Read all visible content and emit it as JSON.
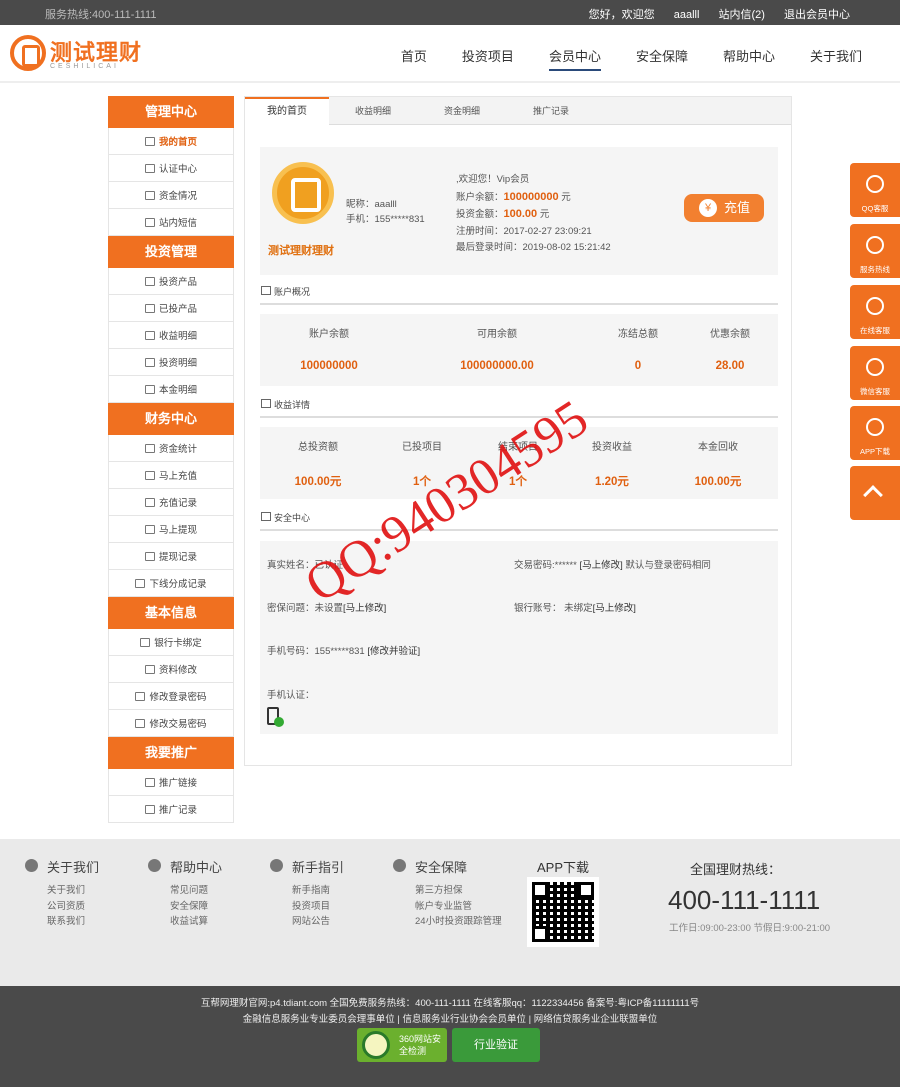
{
  "topbar": {
    "hotline": "服务热线:400-111-1111",
    "greeting": "您好，欢迎您",
    "username": "aaalll",
    "inbox": "站内信(2)",
    "logout": "退出会员中心"
  },
  "logo": {
    "name": "测试理财",
    "sub": "CESHILICAI"
  },
  "nav": [
    "首页",
    "投资项目",
    "会员中心",
    "安全保障",
    "帮助中心",
    "关于我们"
  ],
  "sidebar": [
    {
      "title": "管理中心",
      "items": [
        "我的首页",
        "认证中心",
        "资金情况",
        "站内短信"
      ]
    },
    {
      "title": "投资管理",
      "items": [
        "投资产品",
        "已投产品",
        "收益明细",
        "投资明细",
        "本金明细"
      ]
    },
    {
      "title": "财务中心",
      "items": [
        "资金统计",
        "马上充值",
        "充值记录",
        "马上提现",
        "提现记录",
        "下线分成记录"
      ]
    },
    {
      "title": "基本信息",
      "items": [
        "银行卡绑定",
        "资料修改",
        "修改登录密码",
        "修改交易密码"
      ]
    },
    {
      "title": "我要推广",
      "items": [
        "推广链接",
        "推广记录"
      ]
    }
  ],
  "tabs": [
    "我的首页",
    "收益明细",
    "资金明细",
    "推广记录"
  ],
  "profile": {
    "logo_text": "测试理财理财",
    "nick": "昵称：aaalll",
    "phone": "手机：155*****831",
    "welcome": ",欢迎您！Vip会员",
    "balance_label": "账户余额：",
    "balance": "100000000",
    "balance_unit": "元",
    "invest_label": "投资金额：",
    "invest": "100.00",
    "invest_unit": "元",
    "register": "注册时间：2017-02-27 23:09:21",
    "last_login": "最后登录时间：2019-08-02 15:21:42",
    "charge_label": "充值",
    "charge_icon": "¥"
  },
  "account": {
    "title": "账户概况",
    "labels": [
      "账户余额",
      "可用余额",
      "冻结总额",
      "优惠余额"
    ],
    "values": [
      "100000000",
      "100000000.00",
      "0",
      "28.00"
    ]
  },
  "income": {
    "title": "收益详情",
    "labels": [
      "总投资额",
      "已投项目",
      "结束项目",
      "投资收益",
      "本金回收"
    ],
    "values": [
      "100.00元",
      "1个",
      "1个",
      "1.20元",
      "100.00元"
    ]
  },
  "security": {
    "title": "安全中心",
    "realname": "真实姓名：已认证",
    "trade_pwd": "交易密码:****** ",
    "trade_link": "[马上修改]",
    "trade_note": " 默认与登录密码相同",
    "question": "密保问题：未设置",
    "question_link": "[马上修改]",
    "bank": "银行账号： 未绑定",
    "bank_link": "[马上修改]",
    "mobile": "手机号码：155*****831 ",
    "mobile_link": "[修改并验证]",
    "mobile_auth": "手机认证："
  },
  "floats": [
    "QQ客服",
    "服务热线",
    "在线客服",
    "微信客服",
    "APP下载"
  ],
  "footer": {
    "cols": [
      {
        "title": "关于我们",
        "links": [
          "关于我们",
          "公司资质",
          "联系我们"
        ]
      },
      {
        "title": "帮助中心",
        "links": [
          "常见问题",
          "安全保障",
          "收益试算"
        ]
      },
      {
        "title": "新手指引",
        "links": [
          "新手指南",
          "投资项目",
          "网站公告"
        ]
      },
      {
        "title": "安全保障",
        "links": [
          "第三方担保",
          "帐户专业监管",
          "24小时投资跟踪管理"
        ]
      }
    ],
    "app": "APP下载",
    "hot_label": "全国理财热线：",
    "hot_num": "400-111-1111",
    "hot_time": "工作日:09:00-23:00 节假日:9:00-21:00"
  },
  "bottom": {
    "line1": "互帮网理财官网:p4.tdiant.com 全国免费服务热线：400-111-1111 在线客服qq：1122334456 备案号:粤ICP备11111111号",
    "line2": "金融信息服务业专业委员会理事单位 | 信息服务业行业协会会员单位 | 网络信贷服务业企业联盟单位",
    "badge1": "360网站安全检测",
    "badge2": "行业验证"
  },
  "watermark": "QQ:940304595",
  "colors": {
    "accent": "#f07020",
    "topbar": "#4a4a4a"
  }
}
